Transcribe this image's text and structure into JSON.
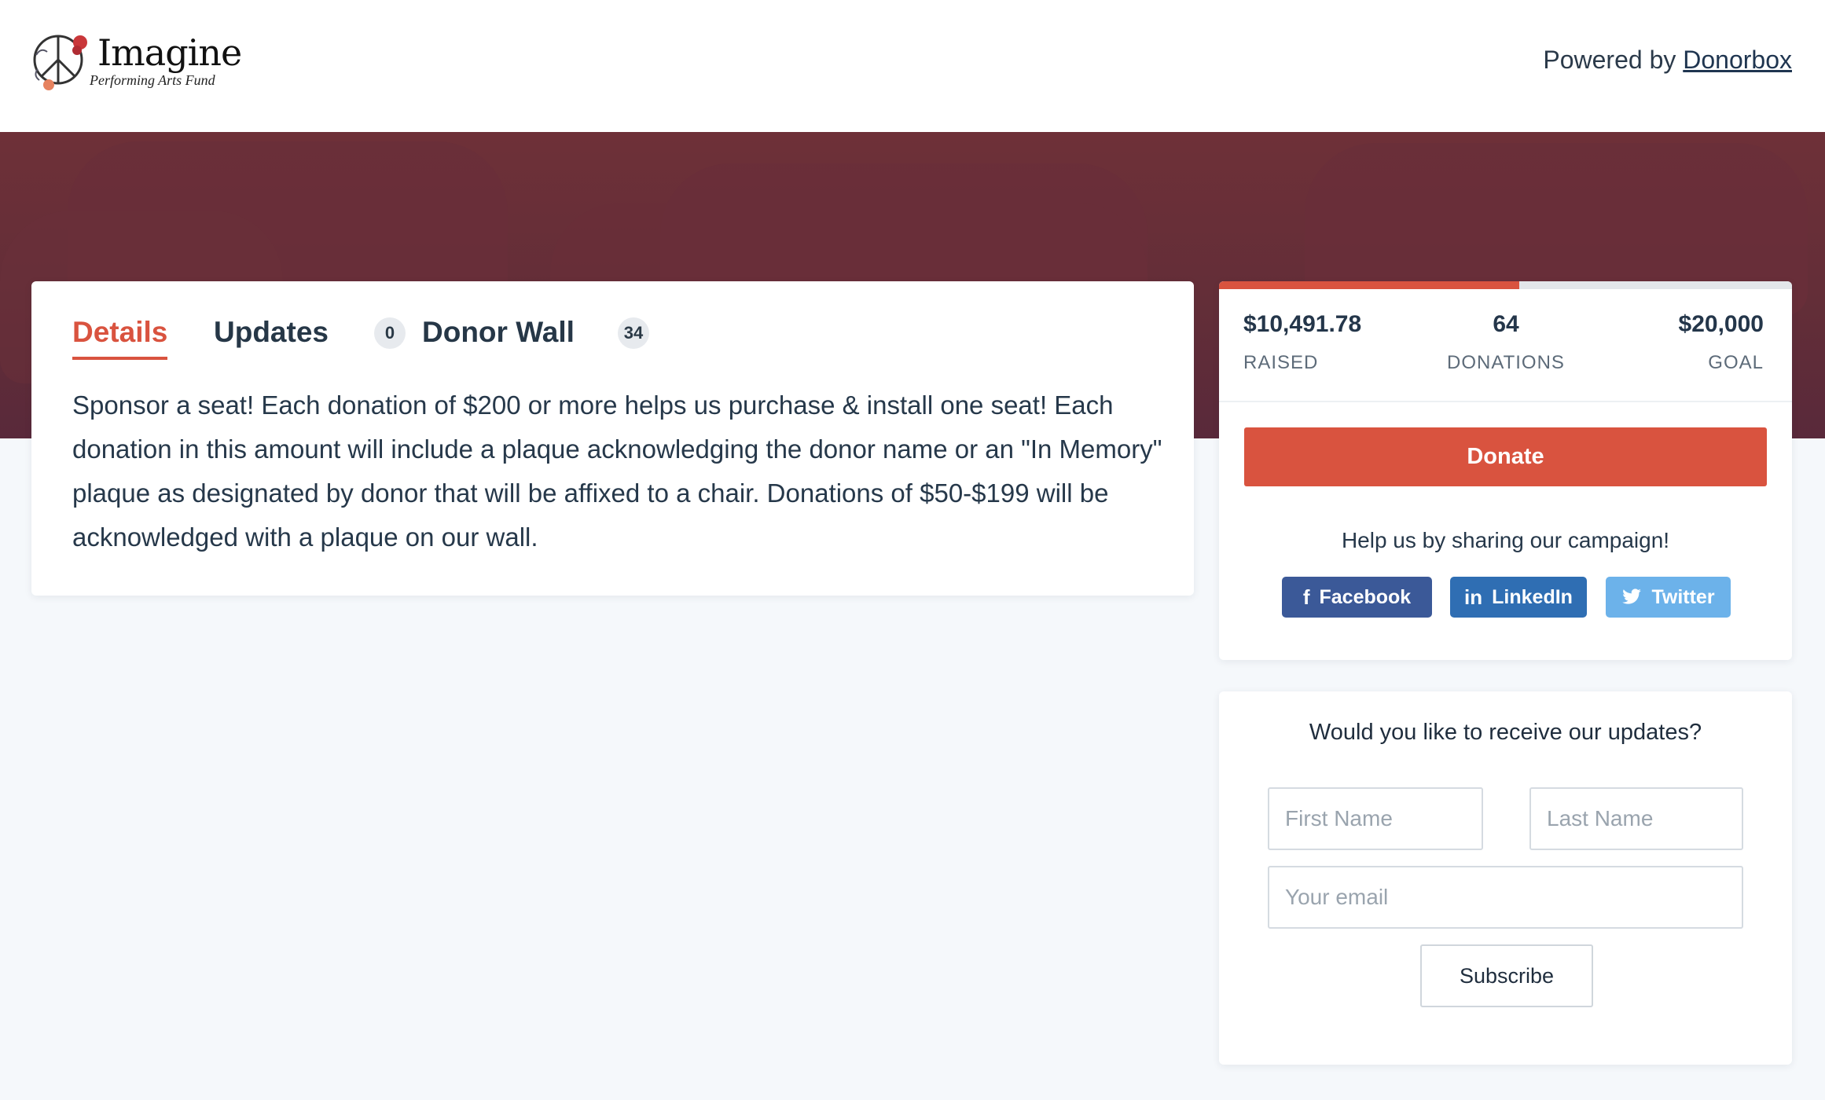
{
  "header": {
    "logo": {
      "name": "Imagine",
      "tagline": "Performing Arts Fund",
      "icon": "peace-sign-flower-icon"
    },
    "powered_prefix": "Powered by",
    "powered_link": "Donorbox"
  },
  "tabs": [
    {
      "label": "Details",
      "active": true
    },
    {
      "label": "Updates",
      "badge": "0"
    },
    {
      "label": "Donor Wall",
      "badge": "34"
    }
  ],
  "details": {
    "text": "Sponsor a seat! Each donation of $200 or more helps us purchase & install one seat! Each donation in this amount will include a plaque acknowledging the donor name or an \"In Memory\" plaque as designated by donor that will be affixed to a chair. Donations of $50-$199 will be acknowledged with a plaque on our wall."
  },
  "campaign": {
    "raised": "$10,491.78",
    "raised_label": "RAISED",
    "donations": "64",
    "donations_label": "DONATIONS",
    "goal": "$20,000",
    "goal_label": "GOAL",
    "progress_fraction": 0.5246
  },
  "donate_button": "Donate",
  "share": {
    "title": "Help us by sharing our campaign!",
    "buttons": [
      {
        "label": "Facebook",
        "icon": "facebook-icon",
        "color": "#3b5998"
      },
      {
        "label": "LinkedIn",
        "icon": "linkedin-icon",
        "color": "#2f6eb3"
      },
      {
        "label": "Twitter",
        "icon": "twitter-icon",
        "color": "#6cb2ea"
      }
    ]
  },
  "subscribe": {
    "title": "Would you like to receive our updates?",
    "first_name_placeholder": "First Name",
    "last_name_placeholder": "Last Name",
    "email_placeholder": "Your email",
    "button": "Subscribe"
  },
  "colors": {
    "accent": "#d9533f",
    "banner": "#632e38",
    "text": "#26384a",
    "page_bg": "#f5f8fb"
  }
}
